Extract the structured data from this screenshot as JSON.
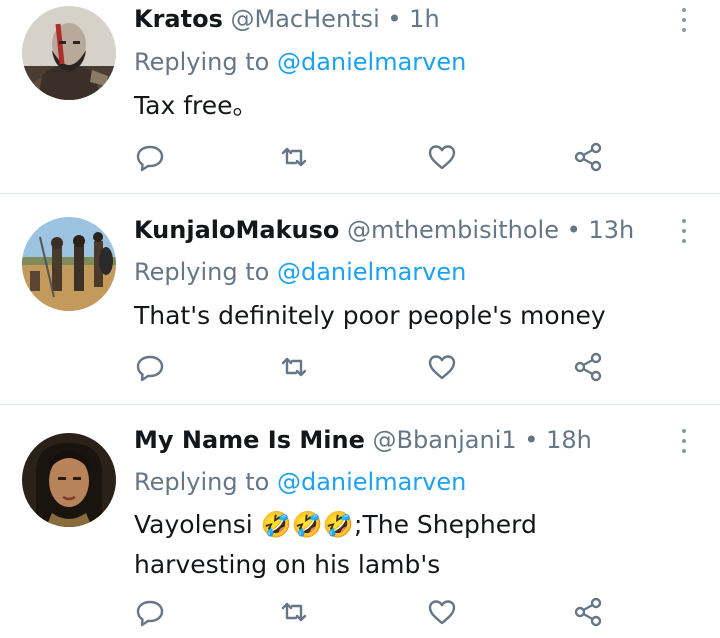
{
  "tweets": [
    {
      "name": "Kratos",
      "handle": "@MacHentsi",
      "separator": "•",
      "time": "1h",
      "replying_prefix": "Replying to",
      "replying_to": "@danielmarven",
      "text": [
        "Tax free。"
      ],
      "avatar": "avatar-kratos"
    },
    {
      "name": "KunjaloMakuso",
      "handle": "@mthembisithole",
      "separator": "•",
      "time": "13h",
      "replying_prefix": "Replying to",
      "replying_to": "@danielmarven",
      "text": [
        "That's definitely poor people's money"
      ],
      "avatar": "avatar-warriors"
    },
    {
      "name": "My Name Is Mine",
      "handle": "@Bbanjani1",
      "separator": "•",
      "time": "18h",
      "replying_prefix": "Replying to",
      "replying_to": "@danielmarven",
      "text": [
        "Vayolensi 🤣🤣🤣;The Shepherd",
        "harvesting on his lamb's"
      ],
      "avatar": "avatar-woman"
    }
  ],
  "icons": {
    "reply": "reply-icon",
    "retweet": "retweet-icon",
    "like": "like-icon",
    "share": "share-icon",
    "menu": "more-options-icon"
  },
  "colors": {
    "link": "#1da1f2",
    "secondary_text": "#657786",
    "icon": "#657786",
    "divider": "#e1e8ed"
  }
}
